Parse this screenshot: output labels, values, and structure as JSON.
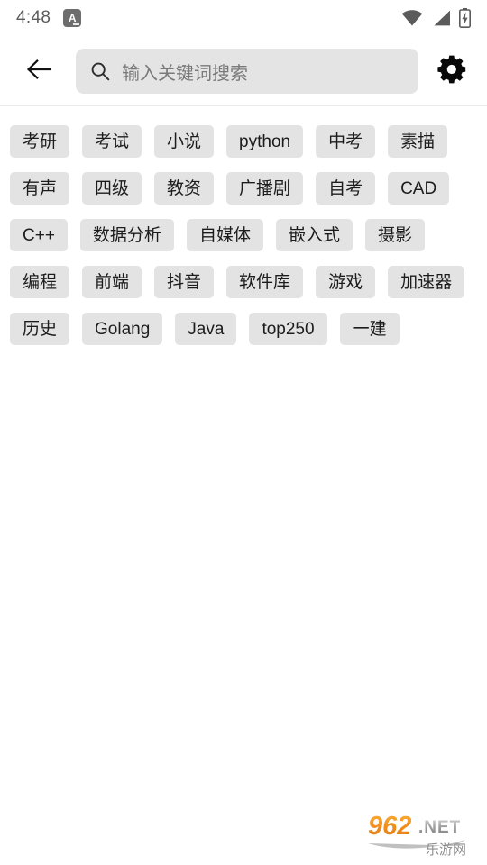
{
  "status_bar": {
    "time": "4:48",
    "ime_badge_label": "A",
    "icons": [
      "wifi-icon",
      "cellular-signal-icon",
      "battery-charging-icon"
    ]
  },
  "header": {
    "back_icon": "back-arrow-icon",
    "settings_icon": "gear-icon",
    "search": {
      "icon": "search-icon",
      "value": "",
      "placeholder": "输入关键词搜索"
    }
  },
  "tags": [
    {
      "label": "考研"
    },
    {
      "label": "考试"
    },
    {
      "label": "小说"
    },
    {
      "label": "python"
    },
    {
      "label": "中考"
    },
    {
      "label": "素描"
    },
    {
      "label": "有声"
    },
    {
      "label": "四级"
    },
    {
      "label": "教资"
    },
    {
      "label": "广播剧"
    },
    {
      "label": "自考"
    },
    {
      "label": "CAD"
    },
    {
      "label": "C++"
    },
    {
      "label": "数据分析"
    },
    {
      "label": "自媒体"
    },
    {
      "label": "嵌入式"
    },
    {
      "label": "摄影"
    },
    {
      "label": "编程"
    },
    {
      "label": "前端"
    },
    {
      "label": "抖音"
    },
    {
      "label": "软件库"
    },
    {
      "label": "游戏"
    },
    {
      "label": "加速器"
    },
    {
      "label": "历史"
    },
    {
      "label": "Golang"
    },
    {
      "label": "Java"
    },
    {
      "label": "top250"
    },
    {
      "label": "一建"
    }
  ],
  "watermark": {
    "primary_text": "962",
    "suffix_text": ".NET",
    "sub_text": "乐游网",
    "primary_color": "#f08c1e",
    "suffix_color": "#9a9a9a"
  },
  "colors": {
    "page_background": "#ffffff",
    "tag_background": "#e3e3e3",
    "tag_text": "#1c1c1c",
    "search_background": "#e4e4e4",
    "placeholder_text": "#7a7a7a",
    "status_text": "#5b5b5b"
  }
}
